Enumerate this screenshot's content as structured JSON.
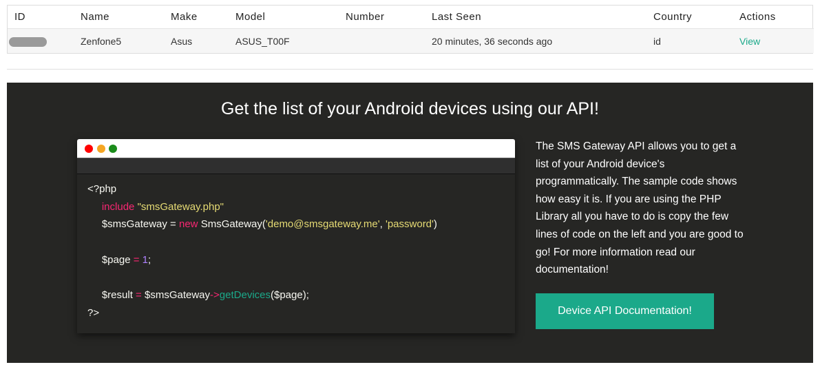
{
  "devices_table": {
    "headers": {
      "id": "ID",
      "name": "Name",
      "make": "Make",
      "model": "Model",
      "number": "Number",
      "last_seen": "Last Seen",
      "country": "Country",
      "actions": "Actions"
    },
    "rows": [
      {
        "name": "Zenfone5",
        "make": "Asus",
        "model": "ASUS_T00F",
        "number": "",
        "last_seen": "20 minutes, 36 seconds ago",
        "country": "id",
        "action_label": "View"
      }
    ]
  },
  "api_section": {
    "title": "Get the list of your Android devices using our API!",
    "code": {
      "open_tag": "<?php",
      "include_kw": "include",
      "include_file": "\"smsGateway.php\"",
      "var_gateway": "$smsGateway",
      "assign": " = ",
      "new_kw": "new",
      "class_name": " SmsGateway(",
      "email": "'demo@smsgateway.me'",
      "comma": ", ",
      "password": "'password'",
      "close_paren": ")",
      "var_page": "$page",
      "assign_op": "=",
      "page_value": "1",
      "semicolon": ";",
      "var_result": "$result",
      "arrow": "->",
      "method": "getDevices",
      "method_args": "($page);",
      "close_tag": "?>"
    },
    "description": "The SMS Gateway API allows you to get a list of your Android device's programmatically. The sample code shows how easy it is. If you are using the PHP Library all you have to do is copy the few lines of code on the left and you are good to go! For more information read our documentation!",
    "button_label": "Device API Documentation!"
  },
  "colors": {
    "accent": "#1ba98a",
    "dark_bg": "#262624",
    "keyword": "#f92672",
    "string": "#e6db74",
    "number": "#ae81ff"
  }
}
